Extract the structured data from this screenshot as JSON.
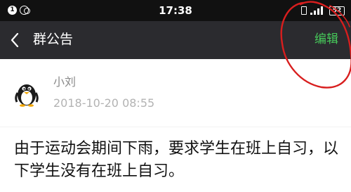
{
  "status_bar": {
    "notification_1": "1",
    "time": "17:38",
    "battery": "52"
  },
  "nav": {
    "title": "群公告",
    "edit_label": "编辑"
  },
  "author": {
    "name": "小刘",
    "timestamp": "2018-10-20 08:55"
  },
  "announcement": {
    "text": "由于运动会期间下雨，要求学生在班上自习，以下学生没有在班上自习。"
  },
  "colors": {
    "status_bar_bg": "#111111",
    "nav_bg": "#2b2b2f",
    "edit_accent": "#46c95a",
    "annotation": "#d81e1e"
  }
}
